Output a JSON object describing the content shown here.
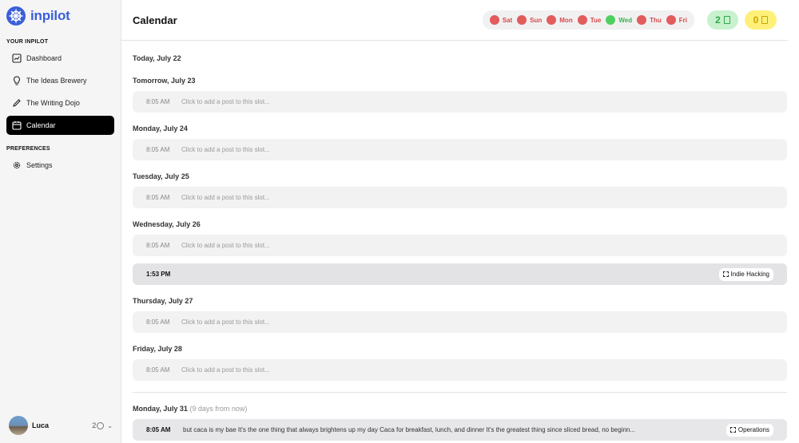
{
  "brand": {
    "name": "inpilot"
  },
  "sidebar": {
    "section_main": "YOUR INPILOT",
    "section_prefs": "PREFERENCES",
    "items": [
      {
        "label": "Dashboard",
        "icon": "chart-icon"
      },
      {
        "label": "The Ideas Brewery",
        "icon": "lightbulb-icon"
      },
      {
        "label": "The Writing Dojo",
        "icon": "pencil-icon"
      },
      {
        "label": "Calendar",
        "icon": "calendar-icon",
        "active": true
      }
    ],
    "settings": {
      "label": "Settings",
      "icon": "gear-icon"
    }
  },
  "user": {
    "name": "Luca",
    "credits": "2"
  },
  "header": {
    "title": "Calendar",
    "days": [
      {
        "label": "Sat",
        "color": "#e25c5c"
      },
      {
        "label": "Sun",
        "color": "#e25c5c"
      },
      {
        "label": "Mon",
        "color": "#e25c5c"
      },
      {
        "label": "Tue",
        "color": "#e25c5c"
      },
      {
        "label": "Wed",
        "color": "#4fcf5f"
      },
      {
        "label": "Thu",
        "color": "#e25c5c"
      },
      {
        "label": "Fri",
        "color": "#e25c5c"
      }
    ],
    "published_count": "2",
    "draft_count": "0"
  },
  "schedule": {
    "today": "Today, July 22",
    "tomorrow": "Tomorrow, July 23",
    "mon": "Monday, July 24",
    "tue": "Tuesday, July 25",
    "wed": "Wednesday, July 26",
    "thu": "Thursday, July 27",
    "fri": "Friday, July 28",
    "nextmon": "Monday, July 31",
    "nextmon_note": "(9 days from now)",
    "slot_time": "8:05 AM",
    "slot_placeholder": "Click to add a post to this slot...",
    "filled_time": "1:53 PM",
    "filled_tag": "Indie Hacking",
    "post_time": "8:05 AM",
    "post_text": "but caca is my bae It's the one thing that always brightens up my day Caca for breakfast, lunch, and dinner It's the greatest thing since sliced bread, no beginn...",
    "post_tag": "Operations"
  }
}
